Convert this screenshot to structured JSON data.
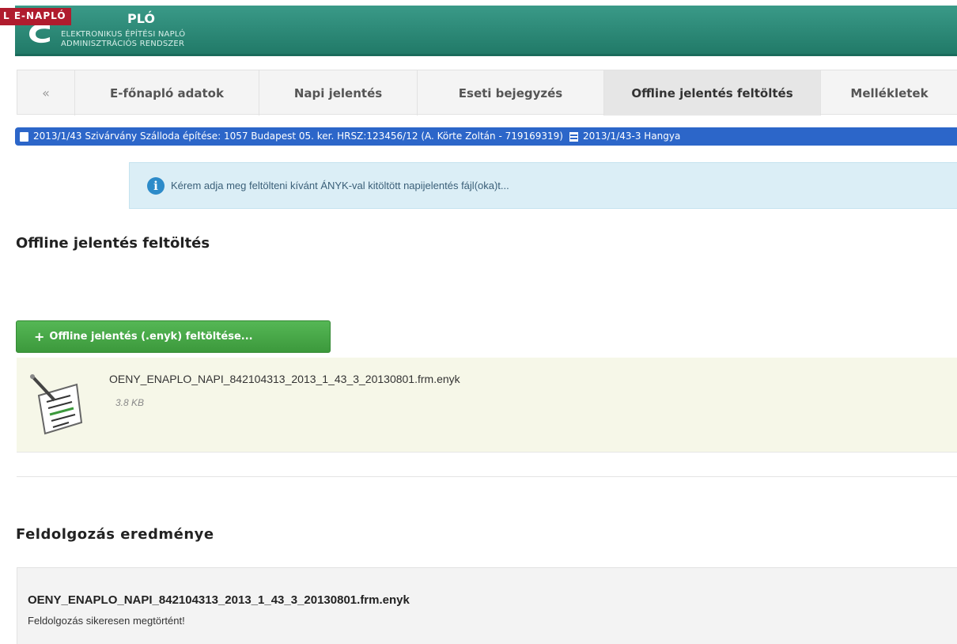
{
  "header": {
    "badge": "L E-NAPLÓ",
    "title": "PLÓ",
    "subtitle_line1": "ELEKTRONIKUS ÉPÍTÉSI NAPLÓ",
    "subtitle_line2": "ADMINISZTRÁCIÓS RENDSZER",
    "brand_color": "#217a68"
  },
  "tabs": {
    "collapse": "«",
    "items": [
      {
        "label": "E-főnapló adatok"
      },
      {
        "label": "Napi jelentés"
      },
      {
        "label": "Eseti bejegyzés"
      },
      {
        "label": "Offline jelentés feltöltés",
        "active": true
      },
      {
        "label": "Mellékletek"
      }
    ]
  },
  "context": {
    "project": "2013/1/43 Szivárvány Szálloda építése: 1057 Budapest 05. ker. HRSZ:123456/12 (A. Körte Zoltán - 719169319)",
    "subproject": "2013/1/43-3 Hangya",
    "color": "#2c66c9"
  },
  "alert": {
    "icon": "info-icon",
    "text": "Kérem adja meg feltölteni kívánt ÁNYK-val kitöltött napijelentés fájl(oka)t..."
  },
  "upload": {
    "heading": "Offline jelentés feltöltés",
    "button_plus": "+",
    "button_label": "Offline jelentés (.enyk) feltöltése...",
    "button_color": "#3c993c",
    "file": {
      "icon": "document-icon",
      "name": "OENY_ENAPLO_NAPI_842104313_2013_1_43_3_20130801.frm.enyk",
      "size": "3.8 KB"
    }
  },
  "result": {
    "heading": "Feldolgozás eredménye",
    "file_name": "OENY_ENAPLO_NAPI_842104313_2013_1_43_3_20130801.frm.enyk",
    "status": "Feldolgozás sikeresen megtörtént!"
  }
}
